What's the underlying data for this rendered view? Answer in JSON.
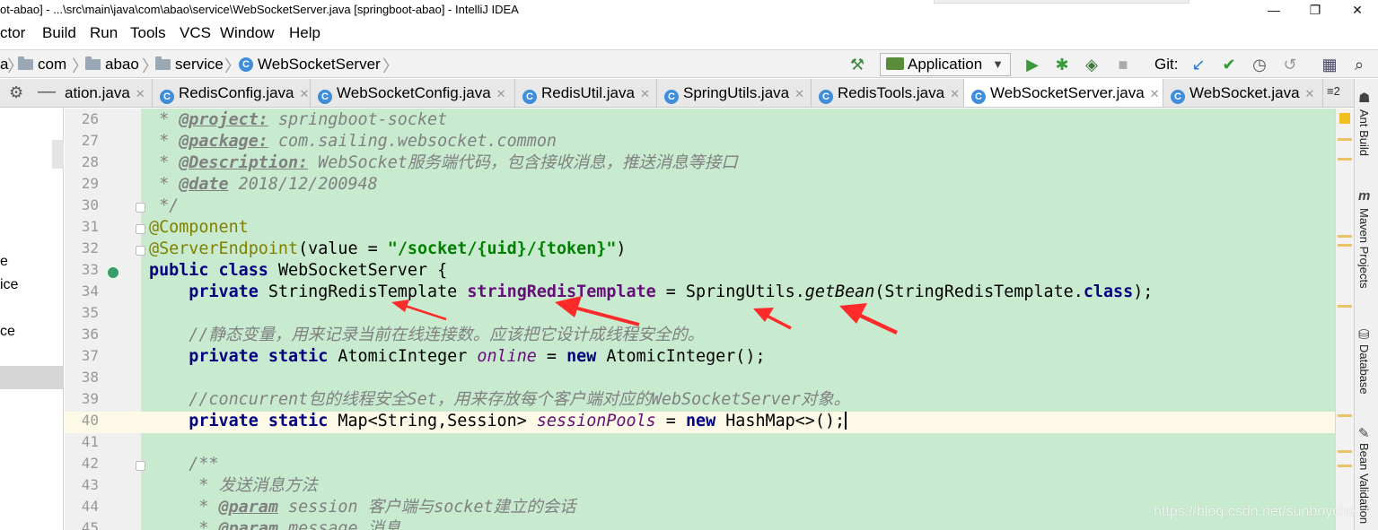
{
  "window": {
    "title": "ot-abao] - ...\\src\\main\\java\\com\\abao\\service\\WebSocketServer.java [springboot-abao] - IntelliJ IDEA",
    "controls": {
      "minimize": "—",
      "restore": "❐",
      "close": "✕"
    }
  },
  "menu": [
    "ctor",
    "Build",
    "Run",
    "Tools",
    "VCS",
    "Window",
    "Help"
  ],
  "breadcrumb": {
    "lead": "a",
    "items": [
      "com",
      "abao",
      "service"
    ],
    "file": "WebSocketServer"
  },
  "toolbar": {
    "run_config": "Application",
    "git_label": "Git:"
  },
  "tabs": [
    {
      "label": "ation.java",
      "active": false
    },
    {
      "label": "RedisConfig.java",
      "active": false
    },
    {
      "label": "WebSocketConfig.java",
      "active": false
    },
    {
      "label": "RedisUtil.java",
      "active": false
    },
    {
      "label": "SpringUtils.java",
      "active": false
    },
    {
      "label": "RedisTools.java",
      "active": false
    },
    {
      "label": "WebSocketServer.java",
      "active": true
    },
    {
      "label": "WebSocket.java",
      "active": false
    }
  ],
  "tab_overflow": "≡2",
  "project_panel": {
    "items": [
      "e",
      "ice",
      "ce"
    ]
  },
  "editor": {
    "line_numbers": [
      "26",
      "27",
      "28",
      "29",
      "30",
      "31",
      "32",
      "33",
      "34",
      "35",
      "36",
      "37",
      "38",
      "39",
      "40",
      "41",
      "42",
      "43",
      "44",
      "45"
    ],
    "current_line": "40",
    "lines": [
      {
        "p": [
          [
            " * ",
            "cm"
          ],
          [
            "@project:",
            "tag"
          ],
          [
            " springboot-socket",
            "cm"
          ]
        ]
      },
      {
        "p": [
          [
            " * ",
            "cm"
          ],
          [
            "@package:",
            "tag"
          ],
          [
            " com.sailing.websocket.common",
            "cm"
          ]
        ]
      },
      {
        "p": [
          [
            " * ",
            "cm"
          ],
          [
            "@Description:",
            "tag"
          ],
          [
            " WebSocket服务端代码，包含接收消息，推送消息等接口",
            "cm"
          ]
        ]
      },
      {
        "p": [
          [
            " * ",
            "cm"
          ],
          [
            "@date",
            "tag"
          ],
          [
            " 2018/12/200948",
            "cm"
          ]
        ]
      },
      {
        "p": [
          [
            " */",
            "cm"
          ]
        ]
      },
      {
        "p": [
          [
            "@Component",
            "ann"
          ]
        ]
      },
      {
        "p": [
          [
            "@ServerEndpoint",
            "ann"
          ],
          [
            "(value = ",
            ""
          ],
          [
            "\"/socket/{uid}/{token}\"",
            "str"
          ],
          [
            ")",
            ""
          ]
        ]
      },
      {
        "p": [
          [
            "public class ",
            "kw"
          ],
          [
            "WebSocketServer {",
            ""
          ]
        ]
      },
      {
        "p": [
          [
            "    ",
            ""
          ],
          [
            "private ",
            "kw"
          ],
          [
            "StringRedisTemplate ",
            ""
          ],
          [
            "stringRedisTemplate",
            "fld"
          ],
          [
            " = SpringUtils.",
            ""
          ],
          [
            "getBean",
            "itc"
          ],
          [
            "(StringRedisTemplate.",
            ""
          ],
          [
            "class",
            "kw"
          ],
          [
            ");",
            ""
          ]
        ]
      },
      {
        "p": [
          [
            "",
            ""
          ]
        ]
      },
      {
        "p": [
          [
            "    ",
            ""
          ],
          [
            "//静态变量，用来记录当前在线连接数。应该把它设计成线程安全的。",
            "cm"
          ]
        ]
      },
      {
        "p": [
          [
            "    ",
            ""
          ],
          [
            "private static ",
            "kw"
          ],
          [
            "AtomicInteger ",
            ""
          ],
          [
            "online",
            "sfld"
          ],
          [
            " = ",
            ""
          ],
          [
            "new ",
            "kw"
          ],
          [
            "AtomicInteger();",
            ""
          ]
        ]
      },
      {
        "p": [
          [
            "",
            ""
          ]
        ]
      },
      {
        "p": [
          [
            "    ",
            ""
          ],
          [
            "//concurrent包的线程安全Set，用来存放每个客户端对应的WebSocketServer对象。",
            "cm"
          ]
        ]
      },
      {
        "p": [
          [
            "    ",
            ""
          ],
          [
            "private static ",
            "kw"
          ],
          [
            "Map<String,Session> ",
            ""
          ],
          [
            "sessionPools",
            "sfld"
          ],
          [
            " = ",
            ""
          ],
          [
            "new ",
            "kw"
          ],
          [
            "HashMap<>();",
            ""
          ]
        ]
      },
      {
        "p": [
          [
            "",
            ""
          ]
        ]
      },
      {
        "p": [
          [
            "    ",
            ""
          ],
          [
            "/**",
            "cm"
          ]
        ]
      },
      {
        "p": [
          [
            "     * 发送消息方法",
            "cm"
          ]
        ]
      },
      {
        "p": [
          [
            "     * ",
            "cm"
          ],
          [
            "@param",
            "tag"
          ],
          [
            " session",
            "cm"
          ],
          [
            " 客户端与socket建立的会话",
            "cm"
          ]
        ]
      },
      {
        "p": [
          [
            "     * ",
            "cm"
          ],
          [
            "@param",
            "tag"
          ],
          [
            " message",
            "cm"
          ],
          [
            " 消息",
            "cm"
          ]
        ]
      }
    ]
  },
  "right_tools": [
    "Ant Build",
    "Maven Projects",
    "Database",
    "Bean Validation"
  ],
  "watermark": "https://blog.csdn.net/sunboyche",
  "colors": {
    "editor_bg": "#c8ebd0",
    "current_line": "#fcfae6",
    "keyword": "#000080",
    "string": "#008000",
    "annotation": "#808000",
    "comment": "#808080",
    "field": "#660e7a",
    "arrow": "#ff2a2a"
  },
  "icons": [
    "gear-icon",
    "hide-icon",
    "folder-icon",
    "class-icon",
    "build-hammer-icon",
    "run-icon",
    "debug-icon",
    "coverage-icon",
    "stop-icon",
    "git-update-icon",
    "git-commit-icon",
    "history-icon",
    "revert-icon",
    "project-structure-icon",
    "search-icon",
    "breakpoint-icon"
  ]
}
